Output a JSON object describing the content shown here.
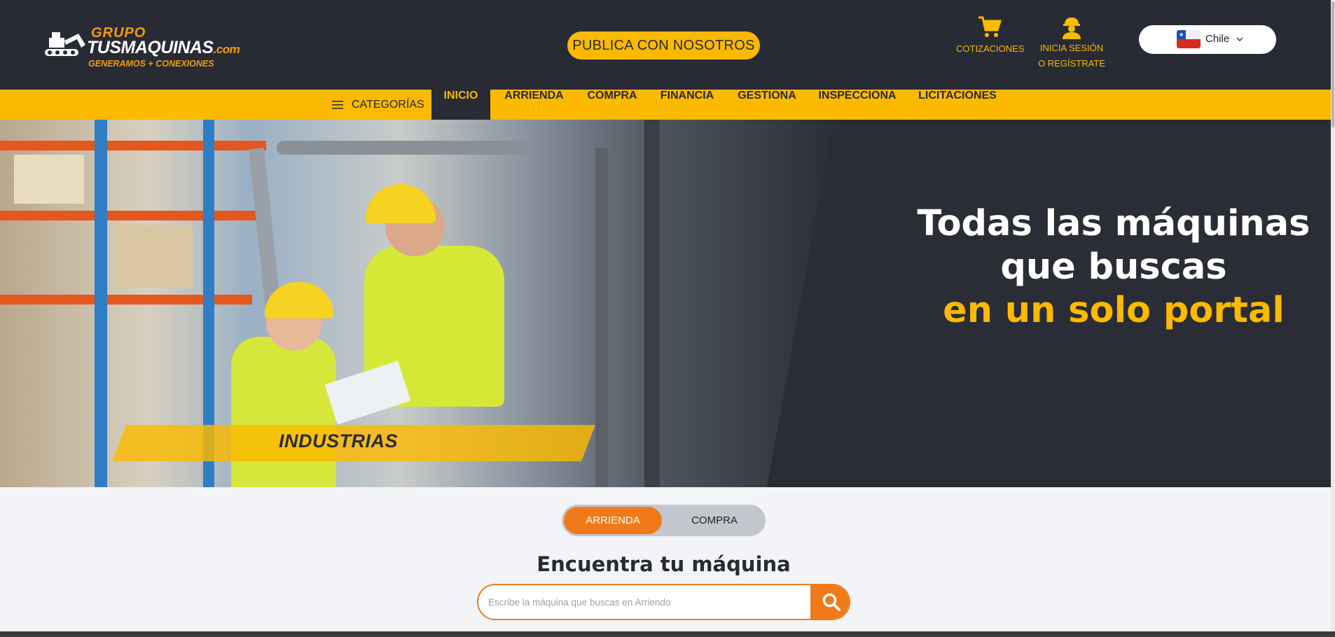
{
  "header": {
    "logo": {
      "top": "GRUPO",
      "main": "TUSMAQUINAS",
      "domain": ".com",
      "tagline": "GENERAMOS + CONEXIONES"
    },
    "publish_label": "PUBLICA CON NOSOTROS",
    "cart_label": "COTIZACIONES",
    "login_line1": "INICIA SESIÓN",
    "login_line2": "O REGÍSTRATE",
    "country": "Chile"
  },
  "nav": {
    "categories_label": "CATEGORÍAS",
    "items": [
      "INICIO",
      "ARRIENDA",
      "COMPRA",
      "FINANCIA",
      "GESTIONA",
      "INSPECCIONA",
      "LICITACIONES"
    ],
    "active": "INICIO"
  },
  "hero": {
    "title_line1": "Todas las máquinas",
    "title_line2": "que buscas",
    "title_accent": "en un solo portal",
    "banner": "INDUSTRIAS"
  },
  "search": {
    "toggle_rent": "ARRIENDA",
    "toggle_buy": "COMPRA",
    "title": "Encuentra tu máquina",
    "placeholder": "Escribe la máquina que buscas en Arriendo",
    "value": ""
  },
  "colors": {
    "brand_yellow": "#fbb900",
    "brand_orange": "#f07a1a",
    "dark": "#282b34"
  },
  "icons": [
    "excavator-icon",
    "cart-icon",
    "worker-icon",
    "chile-flag-icon",
    "chevron-down-icon",
    "hamburger-icon",
    "search-icon"
  ]
}
